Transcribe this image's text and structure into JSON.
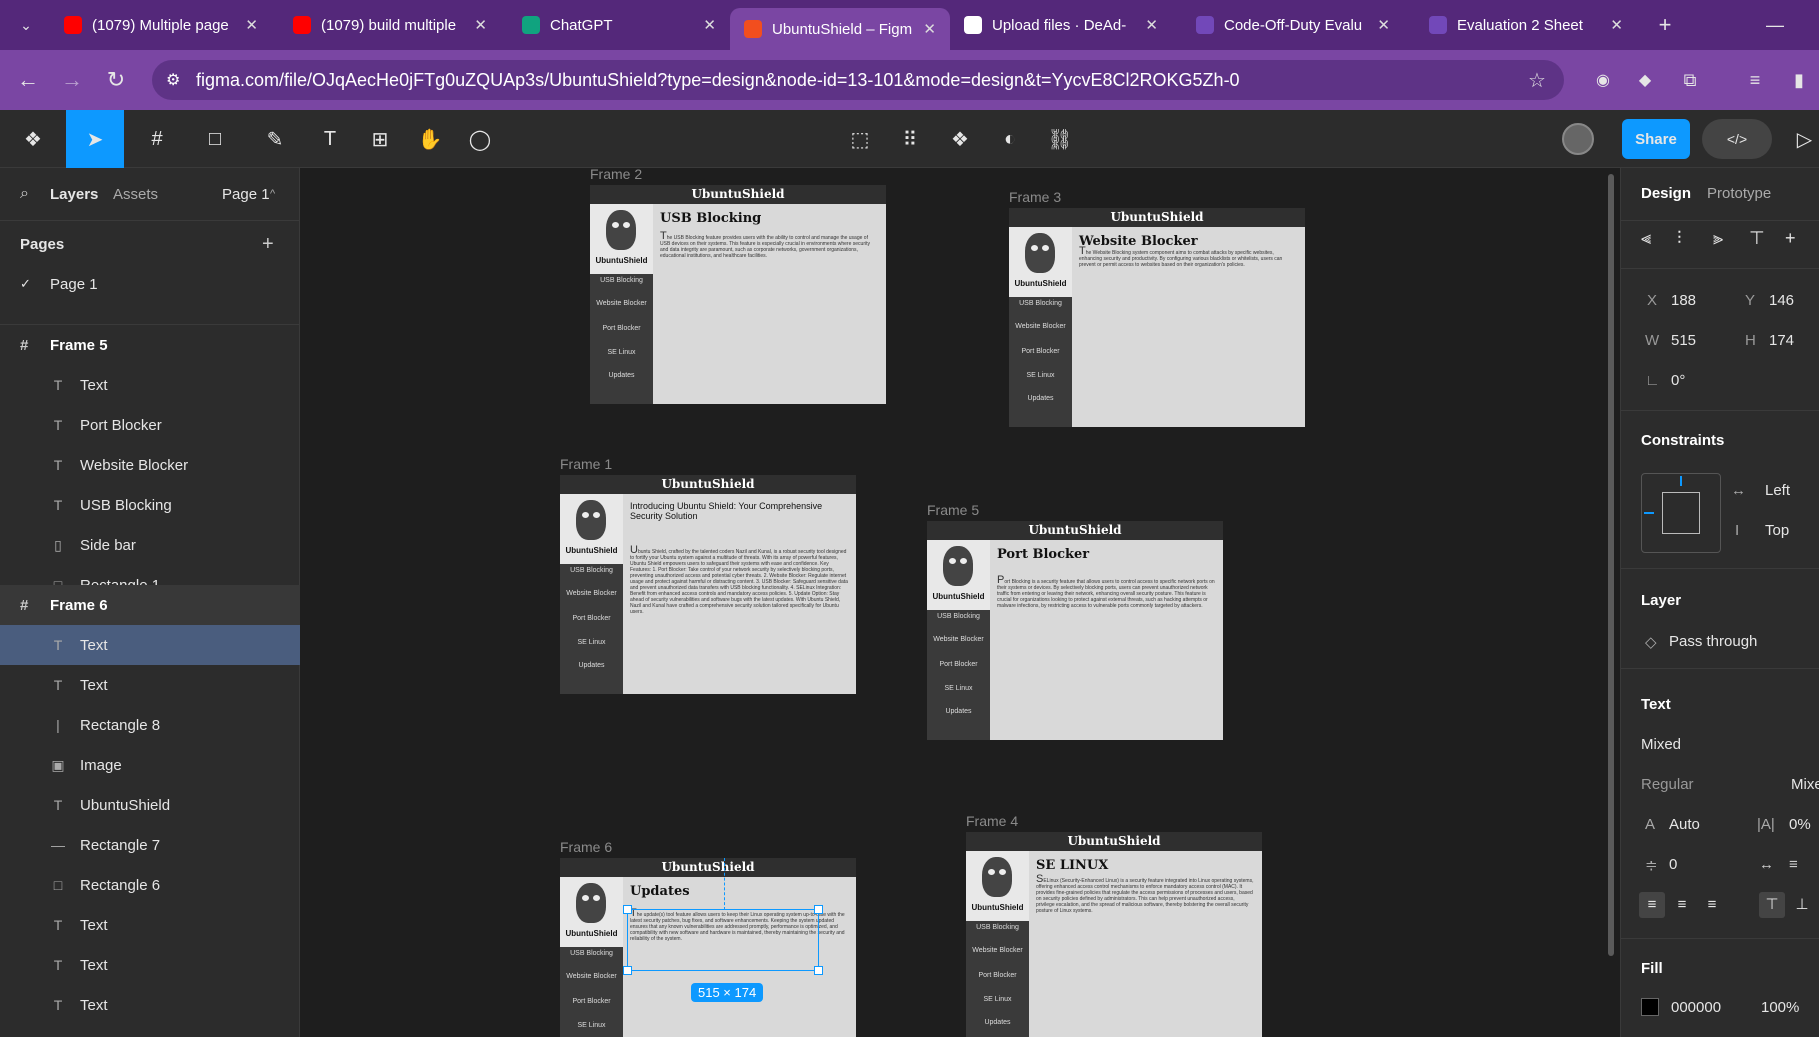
{
  "browser": {
    "tabs": [
      {
        "title": "(1079) Multiple page",
        "icon": "youtube-icon",
        "color": "#ff0000"
      },
      {
        "title": "(1079) build multiple",
        "icon": "youtube-icon",
        "color": "#ff0000"
      },
      {
        "title": "ChatGPT",
        "icon": "chatgpt-icon",
        "color": "#10a37f"
      },
      {
        "title": "UbuntuShield – Figm",
        "icon": "figma-icon",
        "color": "#f24e1e"
      },
      {
        "title": "Upload files · DeAd-",
        "icon": "github-icon",
        "color": "#ffffff"
      },
      {
        "title": "Code-Off-Duty Evalu",
        "icon": "forms-icon",
        "color": "#7248b9"
      },
      {
        "title": "Evaluation 2 Sheet",
        "icon": "forms-icon",
        "color": "#7248b9"
      }
    ],
    "url": "figma.com/file/OJqAecHe0jFTg0uZQUAp3s/UbuntuShield?type=design&node-id=13-101&mode=design&t=YycvE8Cl2ROKG5Zh-0"
  },
  "toolbar": {
    "share": "Share"
  },
  "left": {
    "tabs": {
      "layers": "Layers",
      "assets": "Assets",
      "page": "Page 1"
    },
    "pages_title": "Pages",
    "pages": [
      "Page 1"
    ],
    "frame5": "Frame 5",
    "frame5_layers": [
      {
        "label": "Text",
        "icon": "T"
      },
      {
        "label": "Port Blocker",
        "icon": "T"
      },
      {
        "label": "Website Blocker",
        "icon": "T"
      },
      {
        "label": "USB Blocking",
        "icon": "T"
      },
      {
        "label": "Side bar",
        "icon": "▯"
      },
      {
        "label": "Rectangle 1",
        "icon": "□"
      }
    ],
    "frame6": "Frame 6",
    "frame6_layers": [
      {
        "label": "Text",
        "icon": "T"
      },
      {
        "label": "Text",
        "icon": "T"
      },
      {
        "label": "Rectangle 8",
        "icon": "|"
      },
      {
        "label": "Image",
        "icon": "▣"
      },
      {
        "label": "UbuntuShield",
        "icon": "T"
      },
      {
        "label": "Rectangle 7",
        "icon": "—"
      },
      {
        "label": "Rectangle 6",
        "icon": "□"
      },
      {
        "label": "Text",
        "icon": "T"
      },
      {
        "label": "Text",
        "icon": "T"
      },
      {
        "label": "Text",
        "icon": "T"
      }
    ]
  },
  "canvas": {
    "brand": "UbuntuShield",
    "nav": [
      "USB Blocking",
      "Website Blocker",
      "Port Blocker",
      "SE Linux",
      "Updates"
    ],
    "frames": [
      {
        "label": "Frame 2",
        "title": "USB Blocking",
        "body": "The USB Blocking feature provides users with the ability to control and manage the usage of USB devices on their systems. This feature is especially crucial in environments where security and data integrity are paramount, such as corporate networks, government organizations, educational institutions, and healthcare facilities."
      },
      {
        "label": "Frame 3",
        "title": "Website Blocker",
        "body": "The Website Blocking system component aims to combat attacks by specific websites, enhancing security and productivity. By configuring various blacklists or whitelists, users can prevent or permit access to websites based on their organization's policies."
      },
      {
        "label": "Frame 1",
        "title": "Introducing Ubuntu Shield: Your Comprehensive Security Solution",
        "body": "Ubuntu Shield, crafted by the talented coders Nazil and Kunal, is a robust security tool designed to fortify your Ubuntu system against a multitude of threats. With its array of powerful features, Ubuntu Shield empowers users to safeguard their systems with ease and confidence. Key Features: 1. Port Blocker: Take control of your network security by selectively blocking ports, preventing unauthorized access and potential cyber threats. 2. Website Blocker: Regulate internet usage and protect against harmful or distracting content. 3. USB Blocker: Safeguard sensitive data and prevent unauthorized data transfers with USB blocking functionality. 4. SELinux Integration: Benefit from enhanced access controls and mandatory access policies. 5. Update Option: Stay ahead of security vulnerabilities and software bugs with the latest updates. With Ubuntu Shield, Nazil and Kunal have crafted a comprehensive security solution tailored specifically for Ubuntu users."
      },
      {
        "label": "Frame 5",
        "title": "Port Blocker",
        "body": "Port Blocking is a security feature that allows users to control access to specific network ports on their systems or devices. By selectively blocking ports, users can prevent unauthorized network traffic from entering or leaving their network, enhancing overall security posture. This feature is crucial for organizations looking to protect against external threats, such as hacking attempts or malware infections, by restricting access to vulnerable ports commonly targeted by attackers."
      },
      {
        "label": "Frame 6",
        "title": "Updates",
        "body": "The update(s) tool feature allows users to keep their Linux operating system up-to-date with the latest security patches, bug fixes, and software enhancements. Keeping the system updated ensures that any known vulnerabilities are addressed promptly, performance is optimized, and compatibility with new software and hardware is maintained, thereby maintaining the security and reliability of the system."
      },
      {
        "label": "Frame 4",
        "title": "SE LINUX",
        "body": "SELinux (Security-Enhanced Linux) is a security feature integrated into Linux operating systems, offering enhanced access control mechanisms to enforce mandatory access control (MAC). It provides fine-grained policies that regulate the access permissions of processes and users, based on security policies defined by administrators. This can help prevent unauthorized access, privilege escalation, and the spread of malicious software, thereby bolstering the overall security posture of Linux systems."
      }
    ],
    "selection_size": "515 × 174"
  },
  "right": {
    "tabs": {
      "design": "Design",
      "prototype": "Prototype"
    },
    "x_label": "X",
    "x": "188",
    "y_label": "Y",
    "y": "146",
    "w_label": "W",
    "w": "515",
    "h_label": "H",
    "h": "174",
    "rotation": "0°",
    "constraints_title": "Constraints",
    "constraint_h": "Left",
    "constraint_v": "Top",
    "layer_title": "Layer",
    "blend": "Pass through",
    "text_title": "Text",
    "font": "Mixed",
    "weight": "Regular",
    "size": "Mixe",
    "line_height": "Auto",
    "letter_spacing": "0%",
    "paragraph_spacing": "0",
    "fill_title": "Fill",
    "fill_hex": "000000",
    "fill_opacity": "100%"
  }
}
